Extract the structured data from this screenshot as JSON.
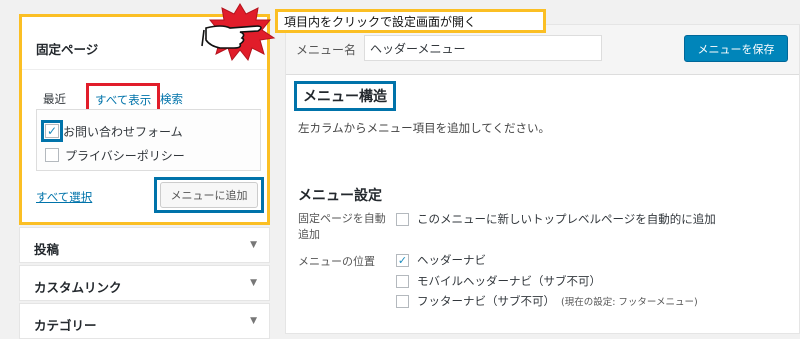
{
  "callout": {
    "text": "項目内をクリックで設定画面が開く"
  },
  "left": {
    "open_panel": {
      "title": "固定ページ",
      "tabs": {
        "recent": "最近",
        "all": "すべて表示",
        "search": "検索"
      },
      "items": [
        {
          "label": "お問い合わせフォーム",
          "checked": true
        },
        {
          "label": "プライバシーポリシー",
          "checked": false
        }
      ],
      "select_all": "すべて選択",
      "add_button": "メニューに追加"
    },
    "closed_panels": [
      {
        "title": "投稿"
      },
      {
        "title": "カスタムリンク"
      },
      {
        "title": "カテゴリー"
      }
    ]
  },
  "right": {
    "menu_name_label": "メニュー名",
    "menu_name_value": "ヘッダーメニュー",
    "save_button": "メニューを保存",
    "structure_title": "メニュー構造",
    "structure_desc": "左カラムからメニュー項目を追加してください。",
    "settings_title": "メニュー設定",
    "auto_add_label": "固定ページを自動追加",
    "auto_add_option": "このメニューに新しいトップレベルページを自動的に追加",
    "location_label": "メニューの位置",
    "locations": [
      {
        "label": "ヘッダーナビ",
        "checked": true,
        "note": ""
      },
      {
        "label": "モバイルヘッダーナビ（サブ不可）",
        "checked": false,
        "note": ""
      },
      {
        "label": "フッターナビ（サブ不可）",
        "checked": false,
        "note": "(現在の設定: フッターメニュー)"
      }
    ]
  },
  "colors": {
    "accent": "#0073aa",
    "highlight_yellow": "#fbbf24",
    "highlight_red": "#e11d2a",
    "primary_button": "#0085ba"
  }
}
